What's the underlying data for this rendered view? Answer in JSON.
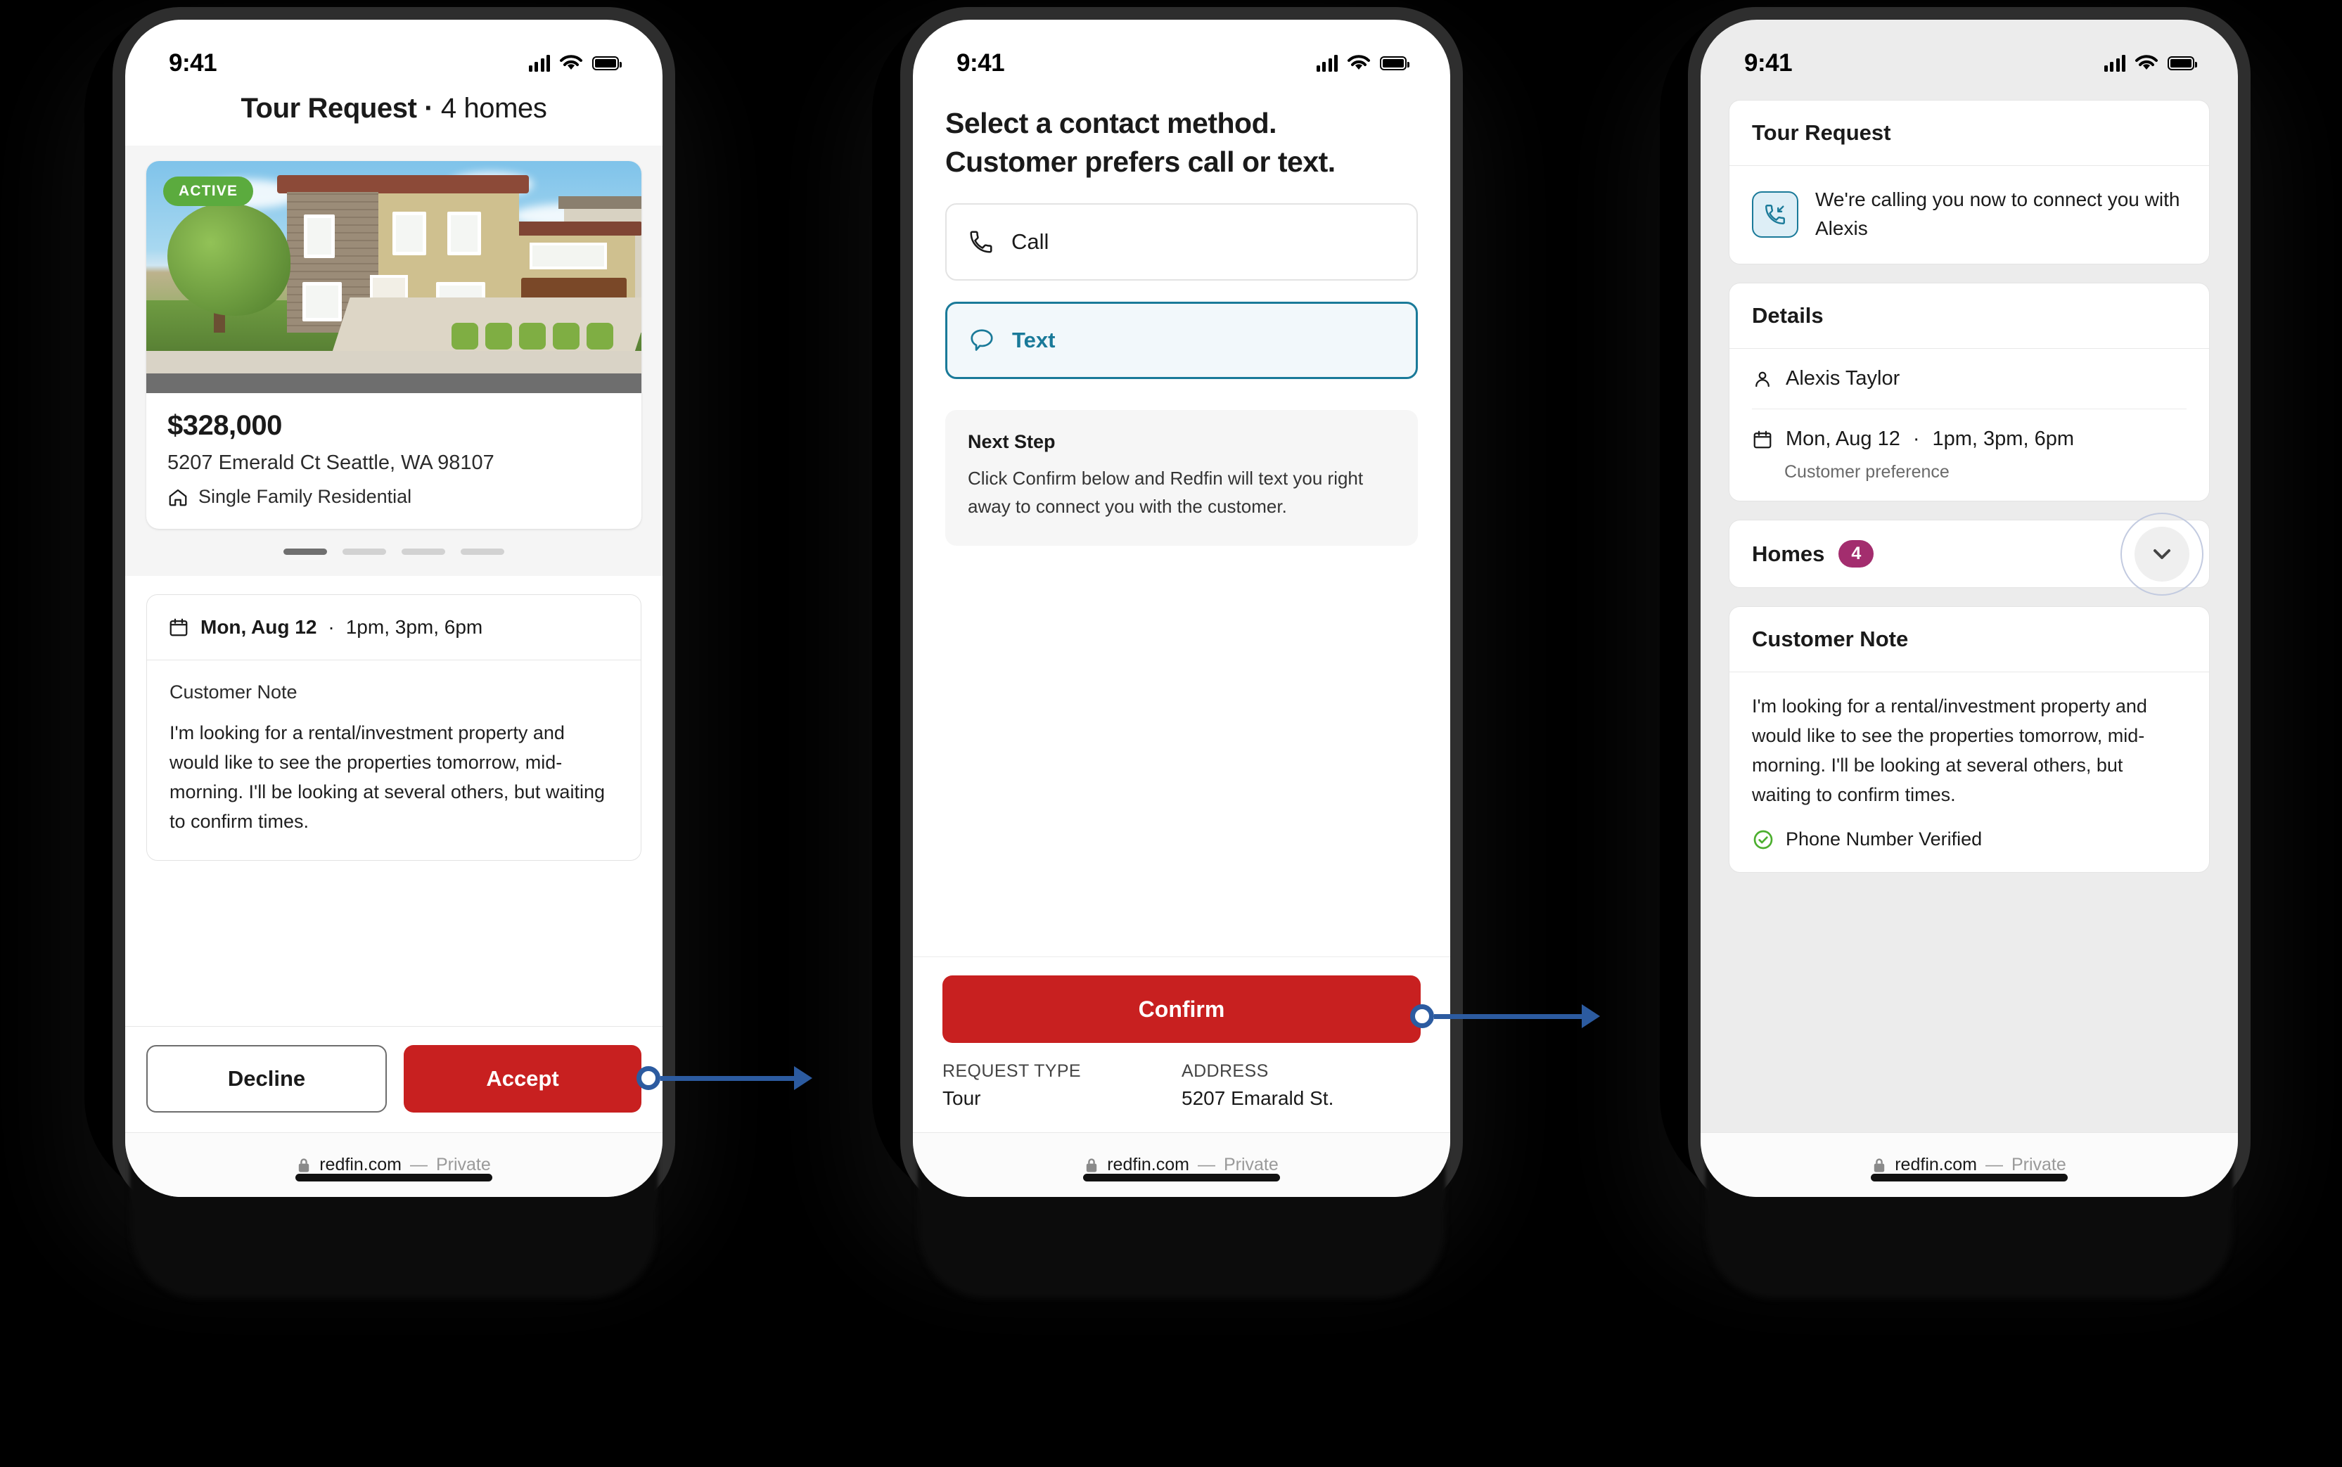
{
  "status_bar": {
    "time": "9:41"
  },
  "browser": {
    "lock_icon": "lock-icon",
    "domain": "redfin.com",
    "separator": "—",
    "mode": "Private"
  },
  "screen1": {
    "title_bold": "Tour Request",
    "title_sep": " · ",
    "title_light": "4 homes",
    "listing": {
      "status_badge": "ACTIVE",
      "price": "$328,000",
      "address": "5207 Emerald Ct Seattle, WA 98107",
      "property_type": "Single Family Residential",
      "home_icon": "home-icon",
      "pager_total": 4,
      "pager_active": 1
    },
    "schedule": {
      "calendar_icon": "calendar-icon",
      "date": "Mon, Aug 12",
      "separator": " · ",
      "times": "1pm, 3pm, 6pm"
    },
    "note": {
      "label": "Customer Note",
      "text": "I'm looking for a rental/investment property and would like to see the properties tomorrow, mid-morning. I'll be looking at several others, but waiting to confirm times."
    },
    "actions": {
      "decline": "Decline",
      "accept": "Accept"
    }
  },
  "screen2": {
    "heading_line1": "Select a contact method.",
    "heading_line2": "Customer prefers call or text.",
    "options": [
      {
        "label": "Call",
        "icon": "phone-icon",
        "selected": false
      },
      {
        "label": "Text",
        "icon": "chat-bubble-icon",
        "selected": true
      }
    ],
    "next_step": {
      "title": "Next Step",
      "text": "Click Confirm below and Redfin will text you right away to connect you with the customer."
    },
    "confirm_label": "Confirm",
    "meta": [
      {
        "label": "REQUEST TYPE",
        "value": "Tour"
      },
      {
        "label": "ADDRESS",
        "value": "5207 Emarald St."
      }
    ]
  },
  "screen3": {
    "tour_request": {
      "title": "Tour Request",
      "icon": "incoming-call-icon",
      "message": "We're calling you now to connect you with Alexis"
    },
    "details": {
      "title": "Details",
      "person_icon": "person-icon",
      "person": "Alexis Taylor",
      "calendar_icon": "calendar-icon",
      "date": "Mon, Aug 12",
      "separator": " · ",
      "times": "1pm, 3pm, 6pm",
      "sub": "Customer preference"
    },
    "homes": {
      "title": "Homes",
      "count": "4",
      "chevron_icon": "chevron-down-icon"
    },
    "customer_note": {
      "title": "Customer Note",
      "text": "I'm looking for a rental/investment property and would like to see the properties tomorrow, mid-morning. I'll be looking at several others, but waiting to confirm times.",
      "verified_icon": "check-circle-icon",
      "verified_label": "Phone Number Verified"
    }
  },
  "colors": {
    "red": "#c82020",
    "teal": "#1a7a99",
    "green": "#5bab3e",
    "magenta": "#a32d6e",
    "arrow_blue": "#2c5ba0"
  }
}
